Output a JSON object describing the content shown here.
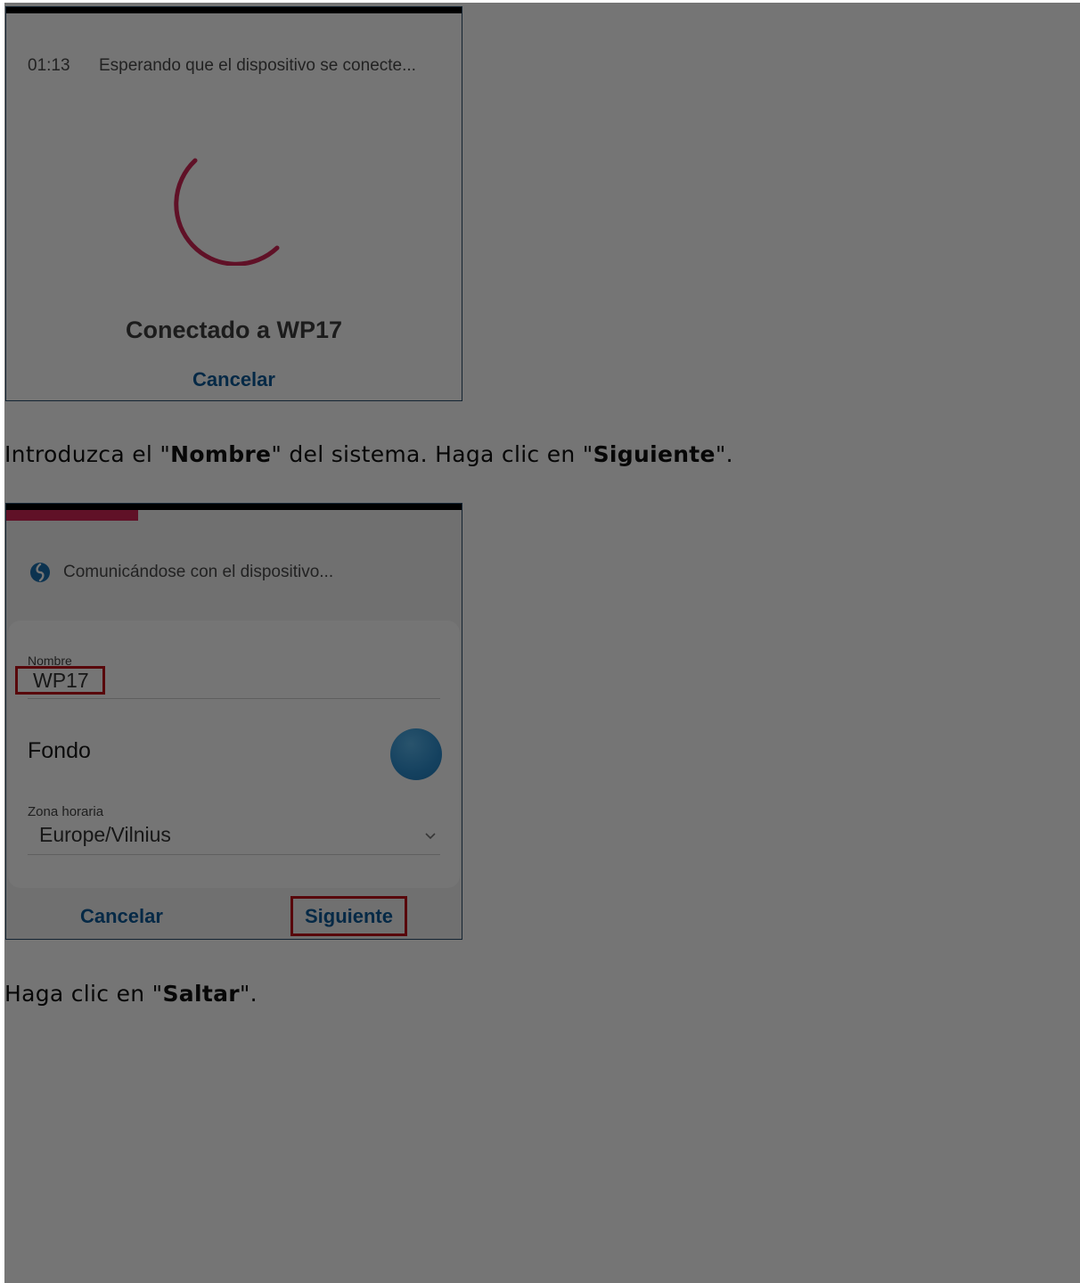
{
  "shot1": {
    "timer": "01:13",
    "waiting_text": "Esperando que el dispositivo se conecte...",
    "connected_text": "Conectado a WP17",
    "cancel_label": "Cancelar"
  },
  "instruction1": {
    "prefix": "Introduzca el \"",
    "bold1": "Nombre",
    "middle": "\" del sistema. Haga clic en \"",
    "bold2": "Siguiente",
    "suffix": "\"."
  },
  "shot2": {
    "progress": 0.29,
    "communicating_text": "Comunicándose con el dispositivo...",
    "name_label": "Nombre",
    "name_value": "WP17",
    "background_label": "Fondo",
    "timezone_label": "Zona horaria",
    "timezone_value": "Europe/Vilnius",
    "cancel_label": "Cancelar",
    "next_label": "Siguiente",
    "colors": {
      "accent": "#d12556",
      "link": "#0b5a99",
      "highlight": "#c0101a"
    }
  },
  "instruction2": {
    "prefix": "Haga clic en \"",
    "bold": "Saltar",
    "suffix": "\"."
  }
}
